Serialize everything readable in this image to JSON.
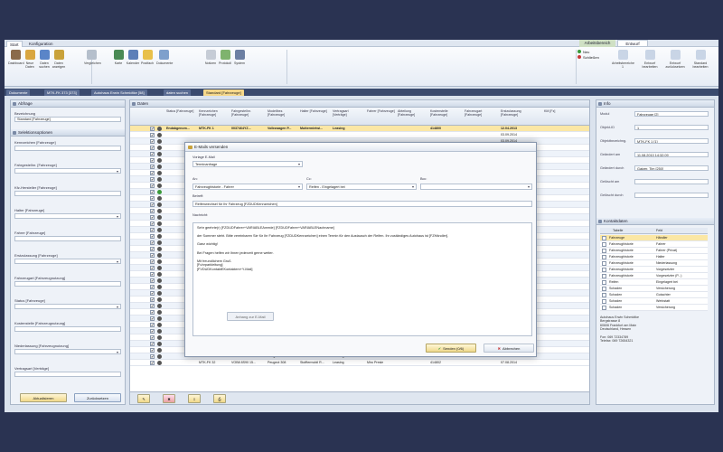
{
  "ribbon": {
    "tabs": [
      "Start",
      "Konfiguration"
    ],
    "context_header": "Arbeitsbereich",
    "context_tab": "Entwurf",
    "buttons": [
      {
        "label": "Dashboard",
        "color": "#8a6a4a"
      },
      {
        "label": "Neue Daten",
        "color": "#d9a640"
      },
      {
        "label": "Daten suchen",
        "color": "#5a85c8"
      },
      {
        "label": "Daten anzeigen",
        "color": "#c9a23a"
      },
      {
        "label": "Vergleichen",
        "color": "#b5bfcc"
      },
      {
        "label": "Karte",
        "color": "#4a8a55"
      },
      {
        "label": "Kalender",
        "color": "#5c7fb8"
      },
      {
        "label": "Postfach",
        "color": "#e8c04a"
      },
      {
        "label": "Dokumente",
        "color": "#7ea0cc"
      },
      {
        "label": "Notizen",
        "color": "#c6ccd6"
      },
      {
        "label": "Protokoll",
        "color": "#7fb36e"
      },
      {
        "label": "System",
        "color": "#6c7fa3"
      }
    ],
    "side_actions": [
      "Neu",
      "Schließen"
    ],
    "arbeit_buttons": [
      "Arbeitsbereiche 1",
      "Entwurf bearbeiten",
      "Entwurf zurücksetzen",
      "Standard bearbeiten"
    ]
  },
  "doc_tabs": [
    "Dokumente",
    "MTK-FK 373 [373]",
    "Autohaus Erwin Schmidtke [58]",
    "daten suchen",
    "Standard [Fahrzeuge]"
  ],
  "left_panel": {
    "title": "Abfrage",
    "fields": [
      {
        "label": "Bezeichnung",
        "value": "Standard [Fahrzeuge]"
      }
    ],
    "section": "Selektionsoptionen",
    "options": [
      "Kennzeichen [Fahrzeuge]",
      "Fahrgestellnr. [Fahrzeuge]",
      "Kfz-Hersteller [Fahrzeuge]",
      "Halter [Fahrzeuge]",
      "Fahrer [Fahrzeuge]",
      "Erstzulassung [Fahrzeuge]",
      "Fahrzeugart [Fahrzeugnutzung]",
      "Status [Fahrzeuge]",
      "Kostenstelle [Fahrzeugnutzung]",
      "Niederlassung [Fahrzeugnutzung]",
      "Vertragsart [Verträge]"
    ],
    "btn_apply": "Aktualisieren",
    "btn_reset": "Zurücksetzen"
  },
  "table": {
    "title": "Daten",
    "headers": [
      "Status [Fahrzeuge]",
      "Kennzeichen [Fahrzeuge]",
      "Fahrgestellnr. [Fahrzeuge]",
      "Modellbez. [Fahrzeuge]",
      "Halter [Fahrzeuge]",
      "Vertragsart [Verträge]",
      "Fahrer [Fahrzeuge]",
      "Abteilung [Fahrzeuge]",
      "Kostenstelle [Fahrzeuge]",
      "Fahrzeugart [Fahrzeuge]",
      "Erstzulassung [Fahrzeuge]",
      "KM [Fz]"
    ],
    "first_row": [
      "Endabgenom...",
      "MTK-FK 1",
      "0037464YZ...",
      "Volkswagen P...",
      "Muttermietwi...",
      "Leasing",
      "",
      "",
      "414800",
      "",
      "12.04.2013"
    ],
    "dates": [
      "03.09.2014",
      "03.09.2014",
      "01.09.2014",
      "29.08.2014",
      "04.08.2014",
      "03.06.2014",
      "03.06.2012",
      "03.06.2012",
      "06.06.2014",
      "03.06.2014",
      "13.01.2014",
      "01.05.2015",
      "01.08.2014",
      "03.09.2014",
      "03.09.2014",
      "03.09.2014",
      "08.08.2014",
      "03.06.2014",
      "03.06.2014",
      "03.06.2014",
      "03.06.2014",
      "01.08.2014",
      "29.08.2014",
      "01.08.2015",
      "03.09.2014",
      "03.06.2014",
      "01.08.2014",
      "01.05.2015",
      "06.10.2014",
      "01.08.2014",
      "01.08.2014",
      "06.08.2014",
      "07.08.2014",
      "07.08.2014"
    ],
    "bottom_rows": [
      [
        "MTK-FK 31",
        "VOB5 8S90F23...",
        "Peugeot 207 CC",
        "Sven Produktio...",
        "Leasing",
        "Lahmer Lalanka",
        "",
        "414862",
        "",
        "06.08.2014"
      ],
      [
        "MTK-FK 33",
        "VOB5 8S90F23...",
        "Peugeot 207 CC",
        "Sven Produktio...",
        "Leasing",
        "Katrine Klemens",
        "",
        "414802",
        "",
        "07.08.2014"
      ],
      [
        "MTK-FK 32",
        "VOB8 8S90 15...",
        "Peugeot 308",
        "Stofftermobil R...",
        "Leasing",
        "Miro Presle",
        "",
        "414802",
        "",
        "07.08.2014"
      ]
    ]
  },
  "modal": {
    "title": "E-Mails versenden",
    "vorlage_label": "Vorlage E-Mail",
    "vorlage_value": "Terminanfrage",
    "an_label": "An:",
    "an_value": "Fahrzeughistorie - Fahrer",
    "cc_label": "Cc:",
    "cc_value": "Reifen - Eingelagert bei",
    "bcc_label": "Bcc:",
    "bcc_value": "",
    "betreff_label": "Betreff:",
    "betreff_value": "Reifenwechsel für Ihr Fahrzeug [FZDUDKennzeichen]",
    "nachricht_label": "Nachricht:",
    "body": [
      "Sehr geehrte(r) [FZDUDFahrer+VARIABLEAnrede] [FZDUDFahrer+VARIABLENachname]",
      "",
      "der Sommer steht. Bitte vereinbaren Sie für Ihr Fahrzeug [FZDUDKennzeichen] einen Termin für den Austausch der Reifen. Ihr zuständiges Autohaus ist [FZHändler].",
      "",
      "Ganz wichtig!",
      "",
      "Bei Fragen helfen wir Ihnen jederzeit gerne weiter.",
      "",
      "Mit freundlichem Gruß",
      "[Fuhrparkleitung]",
      "[FVDUDKontaktEKontaktem+Y-Mail]"
    ],
    "center_button": "Anhang zur E-Mail",
    "send_button": "Senden (0/6)",
    "cancel_button": "Abbrechen"
  },
  "right_panel": {
    "title": "Info",
    "fields": [
      {
        "label": "Modul",
        "value": "Fahrzeuge [2]"
      },
      {
        "label": "Objekt-ID",
        "value": "1"
      },
      {
        "label": "Objektbezeichng.",
        "value": "MTK-FK 1 [1]"
      },
      {
        "label": "Geändert am",
        "value": "11.08.2010 14:32:09"
      },
      {
        "label": "Geändert durch",
        "value": "Gatzer, Tim [250]"
      },
      {
        "label": "Gelöscht am",
        "value": ""
      },
      {
        "label": "Gelöscht durch",
        "value": ""
      }
    ],
    "kontakt_title": "Kontaktdaten",
    "kontakt_headers": [
      "Tabelle",
      "Feld"
    ],
    "kontakt_rows": [
      [
        "Fahrzeuge",
        "Händler"
      ],
      [
        "Fahrzeughistorie",
        "Fahrer"
      ],
      [
        "Fahrzeughistorie",
        "Fahrer (Privat)"
      ],
      [
        "Fahrzeughistorie",
        "Halter"
      ],
      [
        "Fahrzeughistorie",
        "Niederlassung"
      ],
      [
        "Fahrzeughistorie",
        "Vorgesetzter"
      ],
      [
        "Fahrzeughistorie",
        "Vorgesetzter (P...)"
      ],
      [
        "Reifen",
        "Eingelagert bei"
      ],
      [
        "Schaden",
        "Versicherung"
      ],
      [
        "Schaden",
        "Gutachter"
      ],
      [
        "Schaden",
        "Werkstatt"
      ],
      [
        "Schaden",
        "Versicherung"
      ]
    ],
    "address": [
      "Autohaus Erwin Schmidtke",
      "Bergstrasse 8",
      "60606 Frankfurt am Main",
      "Deutschland, Hessen",
      "",
      "Fon: 069 72334789",
      "Telefax: 069 72654321"
    ]
  }
}
